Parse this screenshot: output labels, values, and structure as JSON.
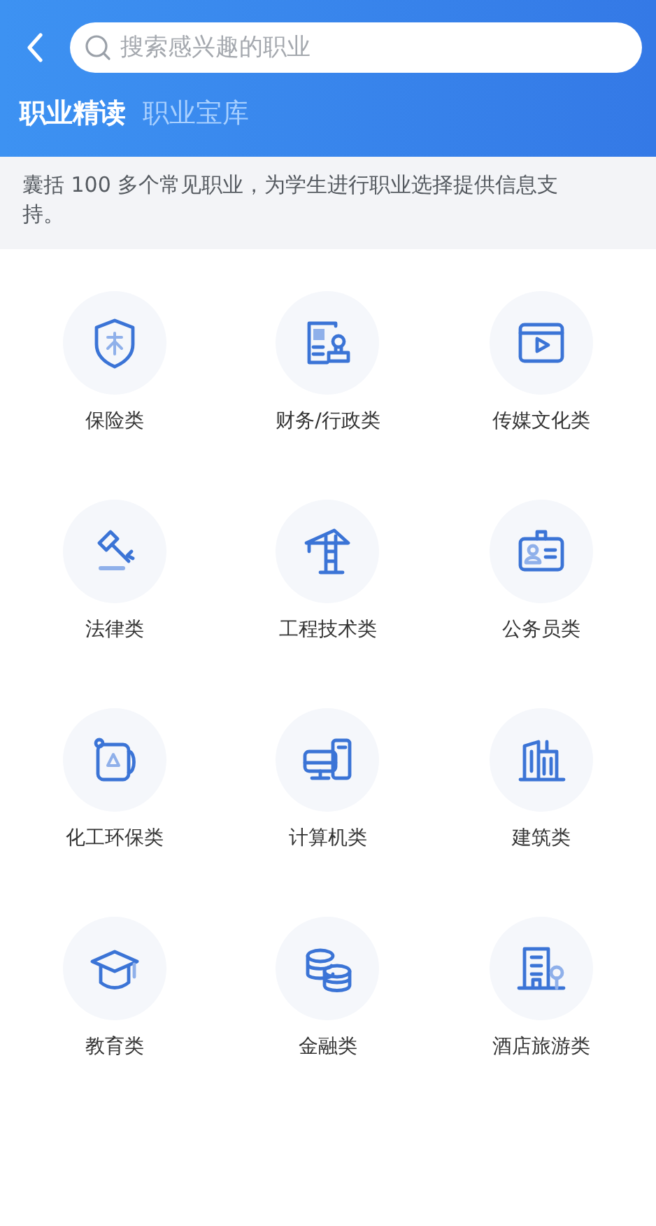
{
  "search": {
    "placeholder": "搜索感兴趣的职业"
  },
  "tabs": [
    {
      "label": "职业精读",
      "selected": true
    },
    {
      "label": "职业宝库",
      "selected": false
    }
  ],
  "description": "囊括 100 多个常见职业，为学生进行职业选择提供信息支持。",
  "categories": [
    {
      "label": "保险类",
      "kind": "shield"
    },
    {
      "label": "财务/行政类",
      "kind": "stamp"
    },
    {
      "label": "传媒文化类",
      "kind": "video"
    },
    {
      "label": "法律类",
      "kind": "gavel"
    },
    {
      "label": "工程技术类",
      "kind": "crane"
    },
    {
      "label": "公务员类",
      "kind": "badge"
    },
    {
      "label": "化工环保类",
      "kind": "recycle"
    },
    {
      "label": "计算机类",
      "kind": "computer"
    },
    {
      "label": "建筑类",
      "kind": "buildings"
    },
    {
      "label": "教育类",
      "kind": "cap"
    },
    {
      "label": "金融类",
      "kind": "coins"
    },
    {
      "label": "酒店旅游类",
      "kind": "hotel"
    }
  ]
}
